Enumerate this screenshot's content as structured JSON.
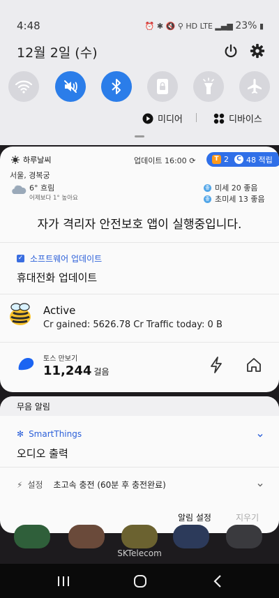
{
  "status_bar": {
    "time": "4:48",
    "network": "HD LTE",
    "battery": "23%"
  },
  "quick_panel": {
    "date": "12월 2일 (수)",
    "tiles": [
      {
        "name": "wifi",
        "on": false
      },
      {
        "name": "mute",
        "on": true
      },
      {
        "name": "bluetooth",
        "on": true
      },
      {
        "name": "portrait-lock",
        "on": false
      },
      {
        "name": "flashlight",
        "on": false
      },
      {
        "name": "airplane-mode",
        "on": false
      }
    ],
    "media_label": "미디어",
    "devices_label": "디바이스"
  },
  "weather": {
    "app": "하루날씨",
    "update": "업데이트 16:00",
    "pill_t": "T",
    "pill_t_count": "2",
    "pill_c": "C",
    "pill_points": "48 적립",
    "location": "서울, 경복궁",
    "temp": "6° 흐림",
    "compare": "어제보다 1° 높아요",
    "aq_badge": "좋",
    "dust": "미세 20 좋음",
    "fine_dust": "초미세 13 좋음"
  },
  "banner": {
    "text": "자가 격리자 안전보호 앱이 실행중입니다."
  },
  "software_update": {
    "app": "소프트웨어 업데이트",
    "title": "휴대전화 업데이트"
  },
  "active": {
    "title": "Active",
    "text": "Cr gained: 5626.78 Cr  Traffic today: 0 B"
  },
  "toss": {
    "app": "토스 만보기",
    "steps": "11,244",
    "unit": "걸음"
  },
  "silent": {
    "header": "무음 알림",
    "smartthings_app": "SmartThings",
    "smartthings_title": "오디오 출력",
    "charging_app": "설정",
    "charging_msg": "초고속 충전 (60분 후 충전완료)",
    "notif_settings": "알림 설정",
    "clear": "지우기"
  },
  "carrier": "SKTelecom",
  "colors": {
    "accent": "#2b7de9",
    "link": "#2b5fd9",
    "pill": "#2f6fe8"
  }
}
